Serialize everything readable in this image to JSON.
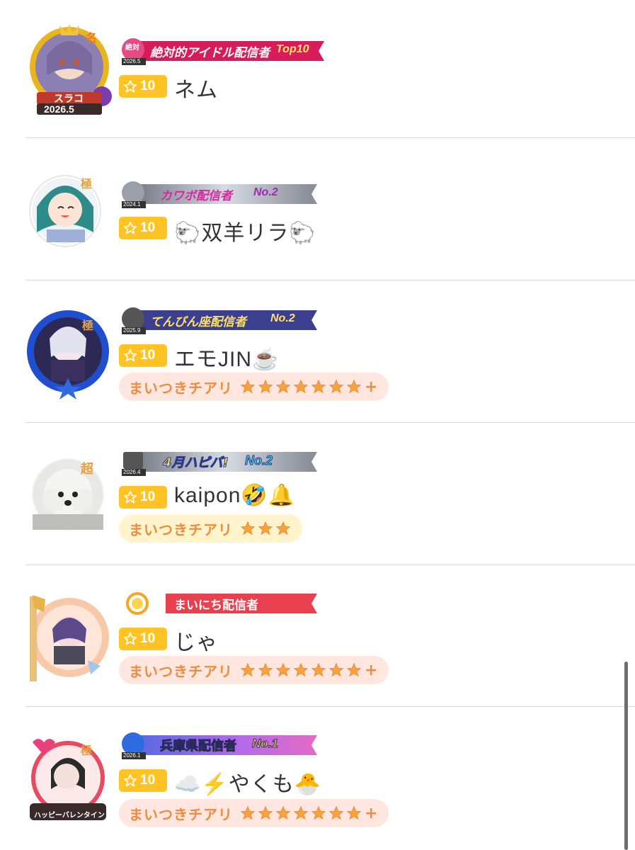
{
  "colors": {
    "level_badge": "#ffc424",
    "cheer_pink_bg": "#ffe6df",
    "cheer_yellow_bg": "#fff4cc",
    "cheer_text": "#f08a3c",
    "divider": "#d9d9d9"
  },
  "rows": [
    {
      "rank_icon": "crown-frame-icon",
      "rank_mark": "名",
      "frame_text": "スラコ",
      "frame_date": "2026.5",
      "badge": {
        "icon": "zettai-icon",
        "icon_text": "絶対",
        "date": "2026.5",
        "title": "絶対的アイドル配信者",
        "suffix": "Top10"
      },
      "level": "10",
      "name": "ネム"
    },
    {
      "rank_mark": "極",
      "badge": {
        "icon": "heart-cloud-icon",
        "date": "2024.1",
        "title": "カワボ配信者",
        "suffix": "No.2"
      },
      "level": "10",
      "name": "🐑双羊リラ🐑"
    },
    {
      "rank_mark": "極",
      "badge": {
        "icon": "libra-icon",
        "date": "2025.9",
        "title": "てんびん座配信者",
        "suffix": "No.2"
      },
      "level": "10",
      "name": "エモJIN☕",
      "cheer": {
        "label": "まいつきチアリ",
        "star_count": 7,
        "plus": "+",
        "style": "pink"
      }
    },
    {
      "rank_mark": "超",
      "badge": {
        "icon": "cake-icon",
        "date": "2026.4",
        "title": "4月ハピバ!",
        "suffix": "No.2"
      },
      "level": "10",
      "name": "kaipon🤣🔔",
      "cheer": {
        "label": "まいつきチアリ",
        "star_count": 3,
        "plus": "",
        "style": "yellow"
      }
    },
    {
      "badge": {
        "icon": "sun-icon",
        "title": "まいにち配信者"
      },
      "level": "10",
      "name": "じゃ",
      "cheer": {
        "label": "まいつきチアリ",
        "star_count": 7,
        "plus": "+",
        "style": "pink"
      }
    },
    {
      "rank_mark": "極",
      "frame_text": "ハッピーバレンタイン",
      "badge": {
        "icon": "ox-icon",
        "date": "2026.1",
        "title": "兵庫県配信者",
        "suffix": "No.1"
      },
      "level": "10",
      "name": "☁️⚡️やくも🐣",
      "cheer": {
        "label": "まいつきチアリ",
        "star_count": 7,
        "plus": "+",
        "style": "pink"
      }
    }
  ]
}
